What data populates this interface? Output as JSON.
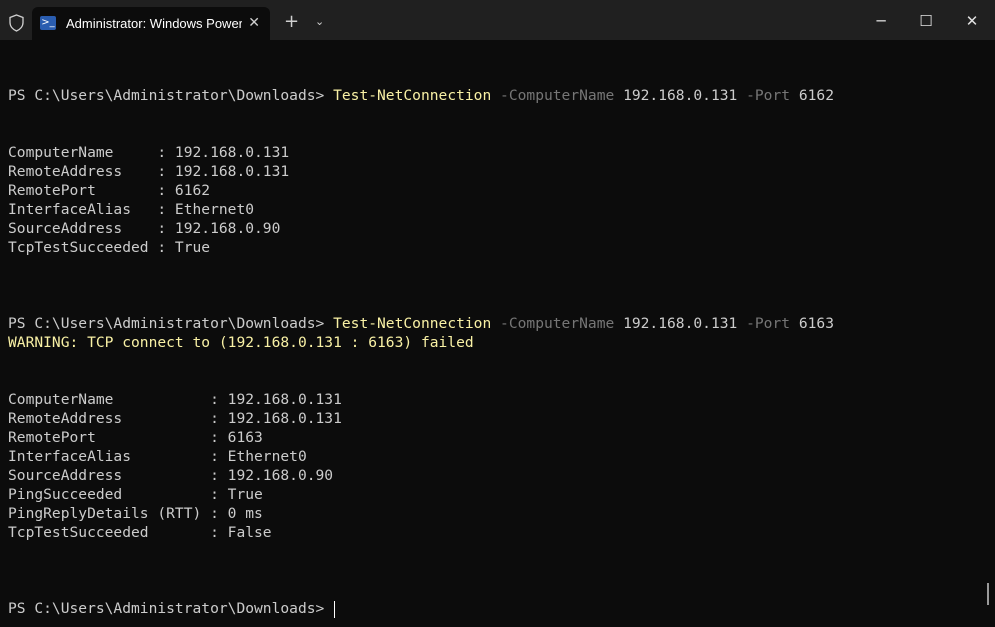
{
  "window": {
    "tab_title": "Administrator: Windows PowerShell",
    "tab_close": "✕",
    "new_tab": "+",
    "dropdown": "⌄",
    "minimize": "─",
    "maximize": "☐",
    "close": "✕"
  },
  "terminal": {
    "prompt": "PS C:\\Users\\Administrator\\Downloads> ",
    "commands": [
      {
        "cmdlet": "Test-NetConnection",
        "param1": "-ComputerName",
        "value1": "192.168.0.131",
        "param2": "-Port",
        "value2": "6162"
      },
      {
        "cmdlet": "Test-NetConnection",
        "param1": "-ComputerName",
        "value1": "192.168.0.131",
        "param2": "-Port",
        "value2": "6163",
        "warning": "WARNING: TCP connect to (192.168.0.131 : 6163) failed"
      }
    ],
    "result1": [
      "ComputerName     : 192.168.0.131",
      "RemoteAddress    : 192.168.0.131",
      "RemotePort       : 6162",
      "InterfaceAlias   : Ethernet0",
      "SourceAddress    : 192.168.0.90",
      "TcpTestSucceeded : True"
    ],
    "result2": [
      "ComputerName           : 192.168.0.131",
      "RemoteAddress          : 192.168.0.131",
      "RemotePort             : 6163",
      "InterfaceAlias         : Ethernet0",
      "SourceAddress          : 192.168.0.90",
      "PingSucceeded          : True",
      "PingReplyDetails (RTT) : 0 ms",
      "TcpTestSucceeded       : False"
    ]
  },
  "colors": {
    "background": "#0c0c0c",
    "text": "#cccccc",
    "command": "#f9f1a5",
    "parameter": "#767676",
    "warning": "#f9f1a5"
  }
}
